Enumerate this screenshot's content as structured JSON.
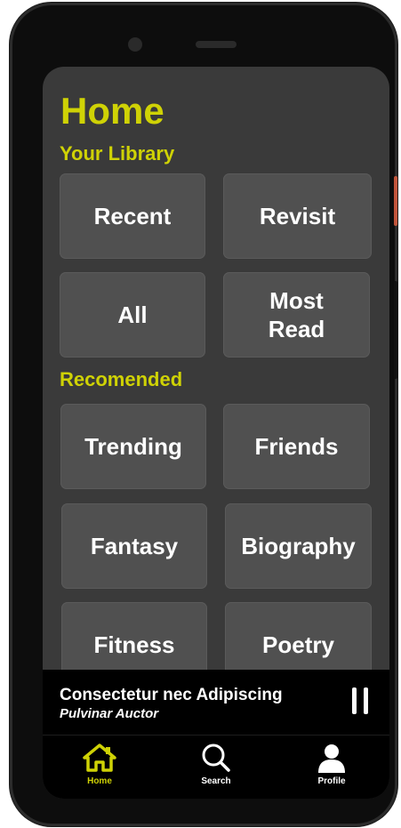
{
  "page": {
    "title": "Home",
    "library_heading": "Your Library",
    "recommended_heading": "Recomended"
  },
  "library": {
    "tiles": [
      "Recent",
      "Revisit",
      "All",
      "Most\nRead"
    ]
  },
  "recommended": {
    "tiles": [
      "Trending",
      "Friends",
      "Fantasy",
      "Biography",
      "Fitness",
      "Poetry"
    ]
  },
  "player": {
    "track": "Consectetur nec Adipiscing",
    "artist": "Pulvinar Auctor",
    "state": "playing"
  },
  "nav": {
    "items": [
      {
        "label": "Home",
        "icon": "home-icon",
        "active": true
      },
      {
        "label": "Search",
        "icon": "search-icon",
        "active": false
      },
      {
        "label": "Profile",
        "icon": "profile-icon",
        "active": false
      }
    ]
  },
  "colors": {
    "accent": "#cfd205",
    "screen_bg": "#3a3a3a",
    "tile_bg": "#505050",
    "bar_bg": "#000000"
  }
}
